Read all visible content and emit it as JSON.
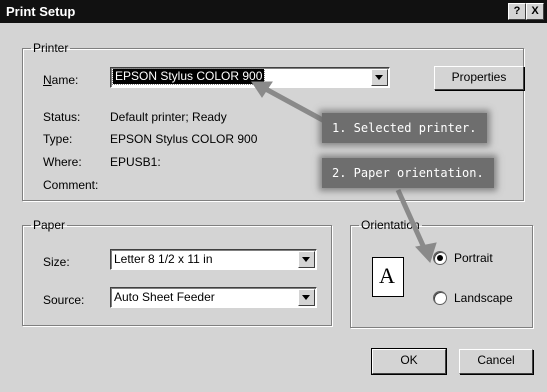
{
  "window": {
    "title": "Print Setup",
    "help_glyph": "?",
    "close_glyph": "X"
  },
  "printer": {
    "group_label": "Printer",
    "name_label": "Name:",
    "name_value": "EPSON Stylus COLOR 900",
    "properties_label": "Properties",
    "status_label": "Status:",
    "status_value": "Default printer; Ready",
    "type_label": "Type:",
    "type_value": "EPSON Stylus COLOR 900",
    "where_label": "Where:",
    "where_value": "EPUSB1:",
    "comment_label": "Comment:",
    "comment_value": ""
  },
  "paper": {
    "group_label": "Paper",
    "size_label": "Size:",
    "size_value": "Letter 8 1/2 x 11 in",
    "source_label": "Source:",
    "source_value": "Auto Sheet Feeder"
  },
  "orientation": {
    "group_label": "Orientation",
    "icon_letter": "A",
    "portrait_label": "Portrait",
    "landscape_label": "Landscape",
    "selected": "Portrait"
  },
  "buttons": {
    "ok_label": "OK",
    "cancel_label": "Cancel"
  },
  "callouts": {
    "first": "1. Selected printer.",
    "second": "2. Paper orientation."
  },
  "colors": {
    "titlebar": "#111111",
    "dialog": "#d4d4d4",
    "callout": "#6e6e6e"
  }
}
